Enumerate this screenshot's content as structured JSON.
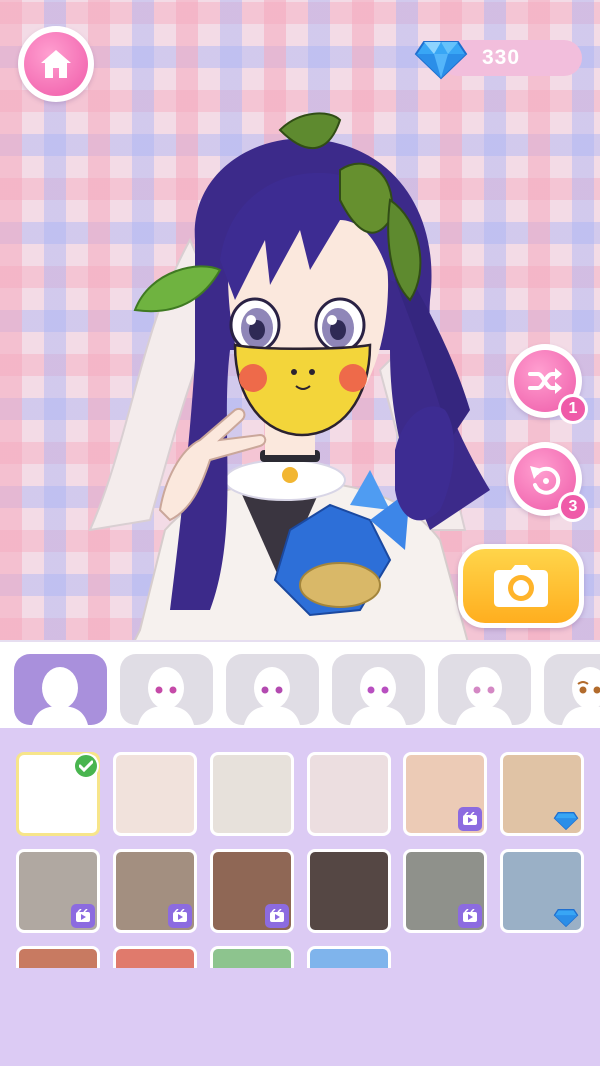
{
  "header": {
    "home_icon": "house-icon",
    "gems": "330",
    "gem_icon": "diamond-icon"
  },
  "actions": {
    "shuffle": {
      "icon": "shuffle-icon",
      "count": "1"
    },
    "undo": {
      "icon": "undo-icon",
      "count": "3"
    },
    "camera": {
      "icon": "camera-icon"
    }
  },
  "categories": [
    {
      "id": "skin",
      "icon": "head-silhouette-icon",
      "active": true
    },
    {
      "id": "eyes-1",
      "icon": "face-eyes-icon",
      "active": false
    },
    {
      "id": "eyes-2",
      "icon": "face-eyes-icon",
      "active": false
    },
    {
      "id": "eyes-3",
      "icon": "face-eyes-icon",
      "active": false
    },
    {
      "id": "eyes-4",
      "icon": "face-eyes-icon",
      "active": false
    },
    {
      "id": "eyes-5",
      "icon": "face-eyes-icon",
      "active": false
    }
  ],
  "swatches": [
    {
      "color": "#ffffff",
      "status": "selected"
    },
    {
      "color": "#f1e2dc",
      "status": "free"
    },
    {
      "color": "#e7e1db",
      "status": "free"
    },
    {
      "color": "#ecdee0",
      "status": "free"
    },
    {
      "color": "#eccbb6",
      "status": "ad"
    },
    {
      "color": "#e0c3a5",
      "status": "gem"
    },
    {
      "color": "#b0a8a1",
      "status": "ad"
    },
    {
      "color": "#a38f80",
      "status": "ad"
    },
    {
      "color": "#8f6755",
      "status": "ad"
    },
    {
      "color": "#554744",
      "status": "free"
    },
    {
      "color": "#8f918b",
      "status": "ad"
    },
    {
      "color": "#9ab0c6",
      "status": "gem"
    },
    {
      "color": "#c87a61",
      "status": "free"
    },
    {
      "color": "#e07a6c",
      "status": "free"
    },
    {
      "color": "#8dc48e",
      "status": "free"
    },
    {
      "color": "#7fb4ec",
      "status": "free"
    }
  ],
  "colors": {
    "accent_pink": "#ef5aa8",
    "camera_yellow": "#ffb92a",
    "active_category": "#a990dc",
    "panel_bg": "#dccbf4"
  }
}
